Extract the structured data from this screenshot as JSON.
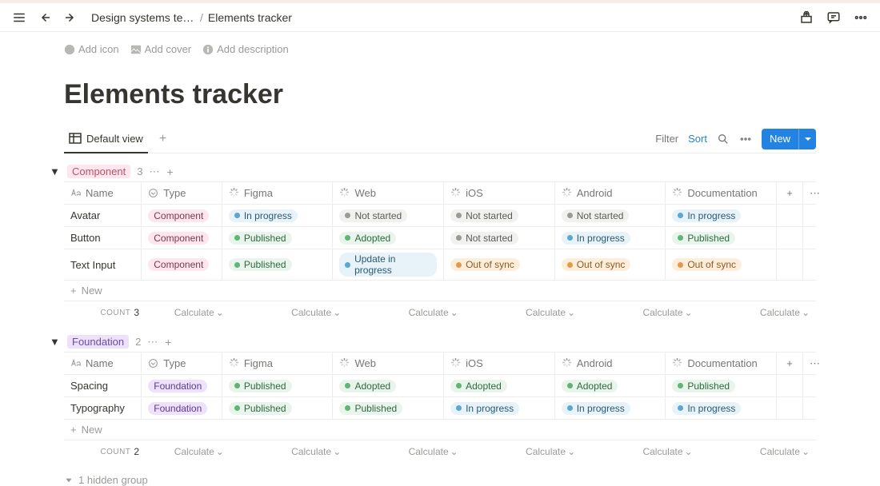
{
  "breadcrumb": {
    "parent": "Design systems tem...",
    "current": "Elements tracker"
  },
  "page_actions": {
    "add_icon": "Add icon",
    "add_cover": "Add cover",
    "add_description": "Add description"
  },
  "page_title": "Elements tracker",
  "view_tabs": {
    "default": "Default view"
  },
  "toolbar": {
    "filter": "Filter",
    "sort": "Sort",
    "new": "New"
  },
  "columns": {
    "name": "Name",
    "type": "Type",
    "figma": "Figma",
    "web": "Web",
    "ios": "iOS",
    "android": "Android",
    "documentation": "Documentation"
  },
  "status_labels": {
    "in_progress": "In progress",
    "not_started": "Not started",
    "published": "Published",
    "adopted": "Adopted",
    "update_in_progress": "Update in progress",
    "out_of_sync": "Out of sync"
  },
  "type_labels": {
    "component": "Component",
    "foundation": "Foundation"
  },
  "groups": [
    {
      "name": "Component",
      "badge_class": "grp-component",
      "count": 3,
      "rows": [
        {
          "name": "Avatar",
          "type": "component",
          "figma": "in_progress",
          "web": "not_started",
          "ios": "not_started",
          "android": "not_started",
          "documentation": "in_progress"
        },
        {
          "name": "Button",
          "type": "component",
          "figma": "published",
          "web": "adopted",
          "ios": "not_started",
          "android": "in_progress",
          "documentation": "published"
        },
        {
          "name": "Text Input",
          "type": "component",
          "figma": "published",
          "web": "update_in_progress",
          "ios": "out_of_sync",
          "android": "out_of_sync",
          "documentation": "out_of_sync"
        }
      ],
      "summary_count": "3"
    },
    {
      "name": "Foundation",
      "badge_class": "grp-foundation",
      "count": 2,
      "rows": [
        {
          "name": "Spacing",
          "type": "foundation",
          "figma": "published",
          "web": "adopted",
          "ios": "adopted",
          "android": "adopted",
          "documentation": "published"
        },
        {
          "name": "Typography",
          "type": "foundation",
          "figma": "published",
          "web": "published",
          "ios": "in_progress",
          "android": "in_progress",
          "documentation": "in_progress"
        }
      ],
      "summary_count": "2"
    }
  ],
  "row_actions": {
    "new": "New",
    "calculate": "Calculate",
    "count_label": "COUNT"
  },
  "hidden_groups": "1 hidden group"
}
